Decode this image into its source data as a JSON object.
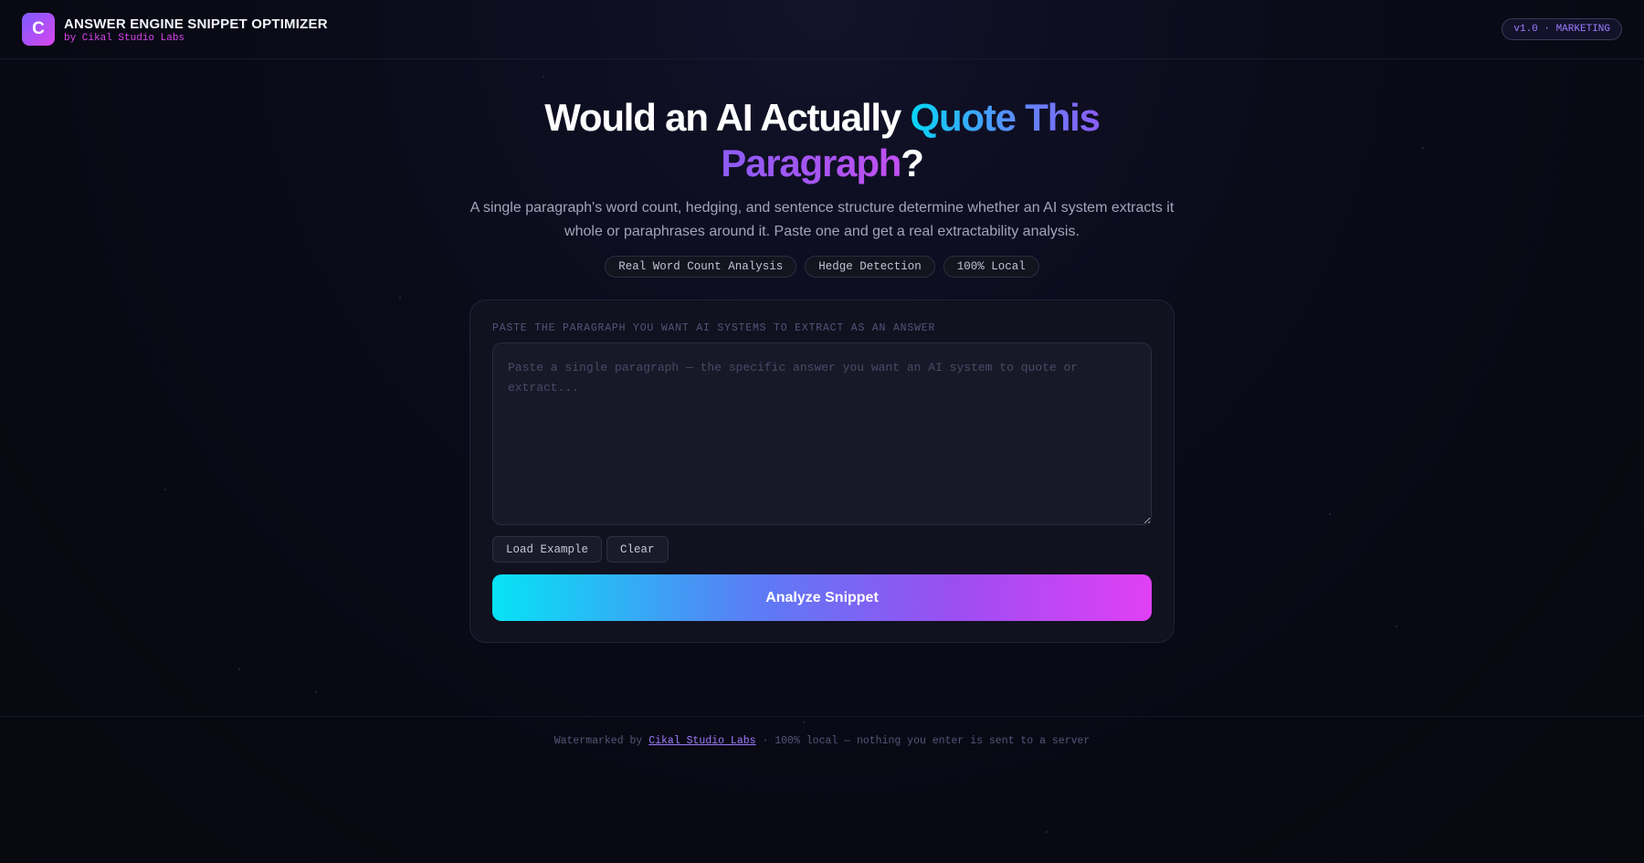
{
  "header": {
    "logo_letter": "C",
    "title": "ANSWER ENGINE SNIPPET OPTIMIZER",
    "subtitle": "by Cikal Studio Labs",
    "version_badge": "v1.0 · MARKETING"
  },
  "hero": {
    "title_part1": "Would an AI Actually ",
    "title_highlight1": "Quote This",
    "title_highlight2": "Paragraph",
    "title_end": "?",
    "description": "A single paragraph's word count, hedging, and sentence structure determine whether an AI system extracts it whole or paraphrases around it. Paste one and get a real extractability analysis.",
    "chips": [
      "Real Word Count Analysis",
      "Hedge Detection",
      "100% Local"
    ]
  },
  "form": {
    "label": "PASTE THE PARAGRAPH YOU WANT AI SYSTEMS TO EXTRACT AS AN ANSWER",
    "placeholder": "Paste a single paragraph — the specific answer you want an AI system to quote or extract...",
    "value": "",
    "load_example_label": "Load Example",
    "clear_label": "Clear",
    "analyze_label": "Analyze Snippet"
  },
  "footer": {
    "prefix": "Watermarked by",
    "link_text": "Cikal Studio Labs",
    "suffix": "· 100% local — nothing you enter is sent to a server"
  },
  "colors": {
    "background": "#090916",
    "accent_cyan": "#06d6f5",
    "accent_purple": "#8b5cf6",
    "accent_magenta": "#d946ef"
  }
}
